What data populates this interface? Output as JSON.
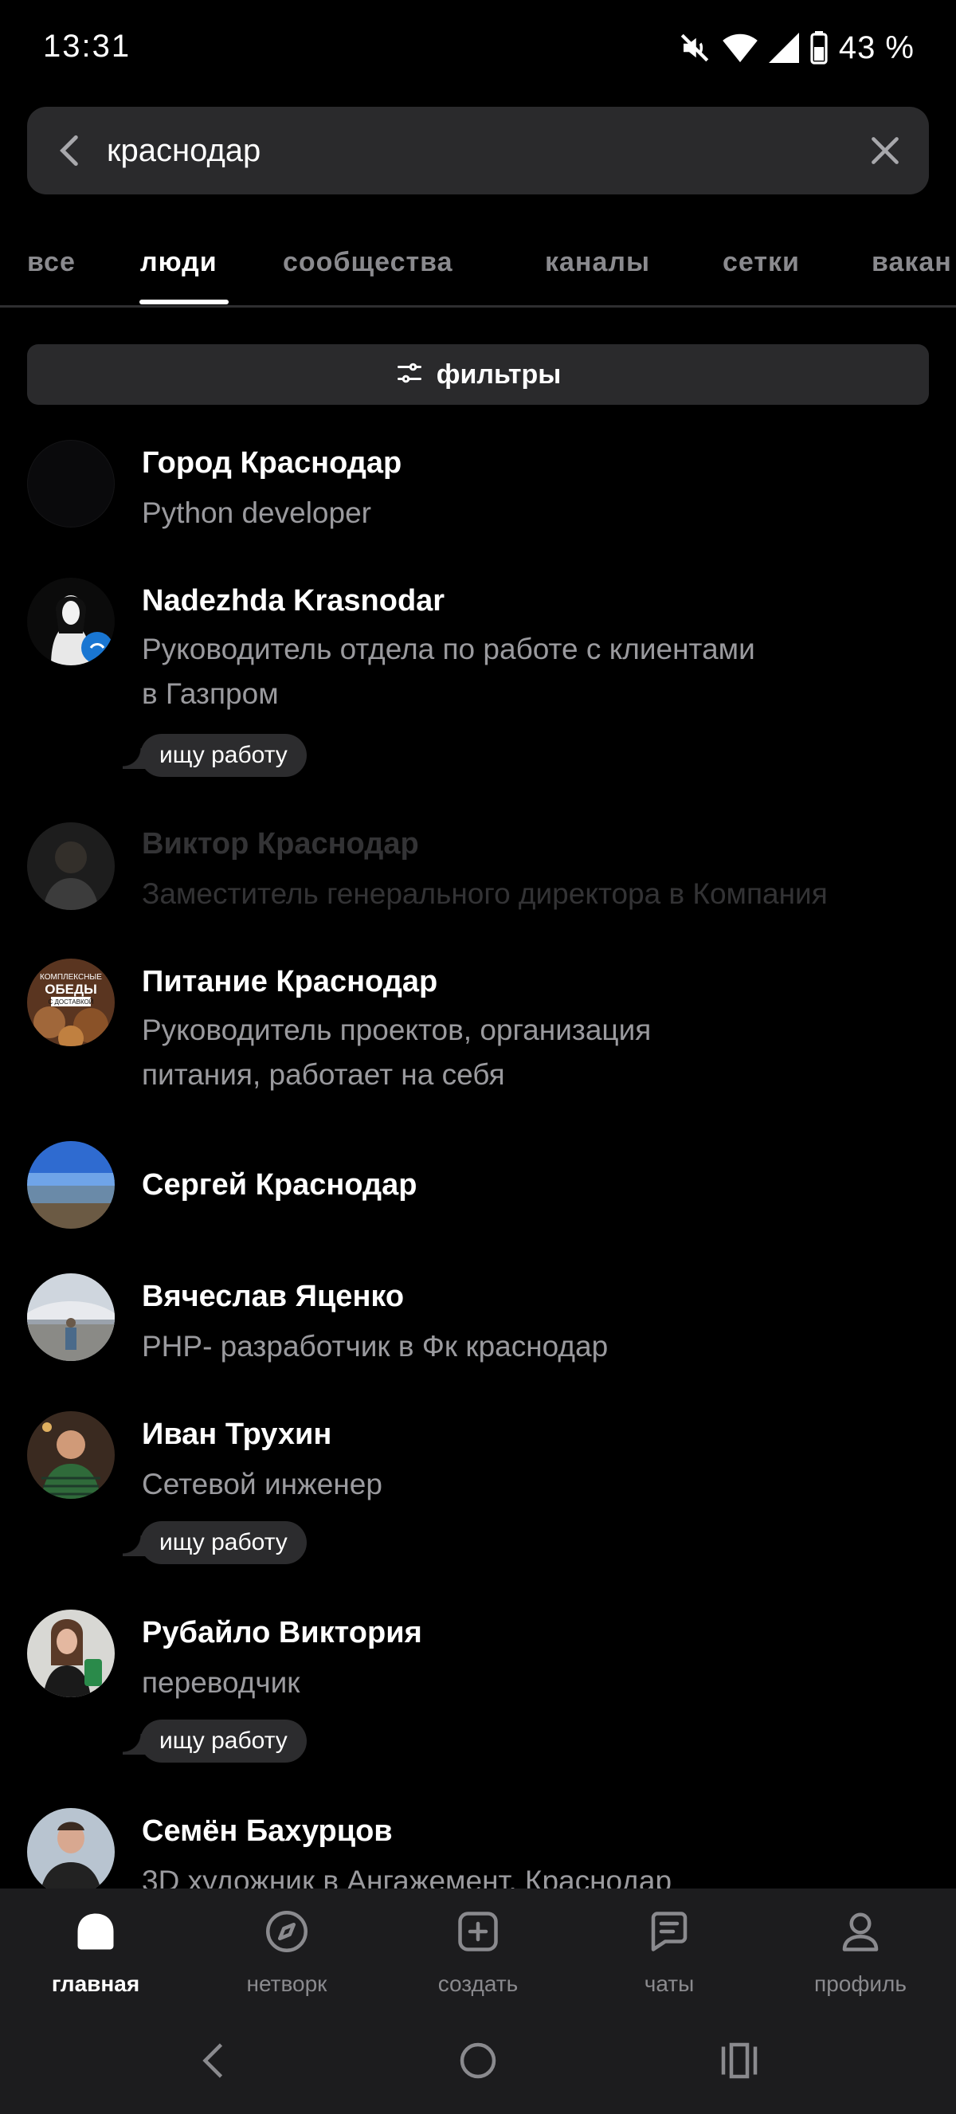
{
  "status": {
    "time": "13:31",
    "battery": "43 %",
    "icons": [
      "mute-icon",
      "wifi-icon",
      "signal-icon",
      "battery-icon"
    ]
  },
  "search": {
    "value": "краснодар",
    "placeholder": ""
  },
  "tabs": [
    {
      "label": "все",
      "active": false
    },
    {
      "label": "люди",
      "active": true
    },
    {
      "label": "сообщества",
      "active": false
    },
    {
      "label": "каналы",
      "active": false
    },
    {
      "label": "сетки",
      "active": false
    },
    {
      "label": "вакан",
      "active": false
    }
  ],
  "filters": {
    "label": "фильтры"
  },
  "people": [
    {
      "name": "Город Краснодар",
      "role": "Python developer"
    },
    {
      "name": "Nadezhda Krasnodar",
      "role_lines": [
        "Руководитель отдела по работе с клиентами",
        "в Газпром"
      ],
      "badge": "ищу работу"
    },
    {
      "name": "Виктор Краснодар",
      "role": "Заместитель генерального директора в Компания"
    },
    {
      "name": "Питание Краснодар",
      "role_lines": [
        "Руководитель проектов, организация",
        "питания, работает на себя"
      ],
      "avatar_text": [
        "КОМПЛЕКСНЫЕ",
        "ОБЕДЫ",
        "С ДОСТАВКОЙ"
      ]
    },
    {
      "name": "Сергей Краснодар"
    },
    {
      "name": "Вячеслав Яценко",
      "role": "PHP- разработчик в Фк краснодар"
    },
    {
      "name": "Иван Трухин",
      "role": "Сетевой инженер",
      "badge": "ищу работу"
    },
    {
      "name": "Рубайло Виктория",
      "role": "переводчик",
      "badge": "ищу работу"
    },
    {
      "name": "Семён Бахурцов",
      "role": "3D художник в Ангажемент, Краснодар"
    }
  ],
  "nav": [
    {
      "label": "главная",
      "icon": "home-icon",
      "active": true
    },
    {
      "label": "нетворк",
      "icon": "compass-icon",
      "active": false
    },
    {
      "label": "создать",
      "icon": "plus-square-icon",
      "active": false
    },
    {
      "label": "чаты",
      "icon": "chat-icon",
      "active": false
    },
    {
      "label": "профиль",
      "icon": "profile-icon",
      "active": false
    }
  ],
  "colors": {
    "background": "#000000",
    "surface": "#2a2a2c",
    "nav_background": "#1c1c1e",
    "secondary_text": "#9a9a9e"
  }
}
